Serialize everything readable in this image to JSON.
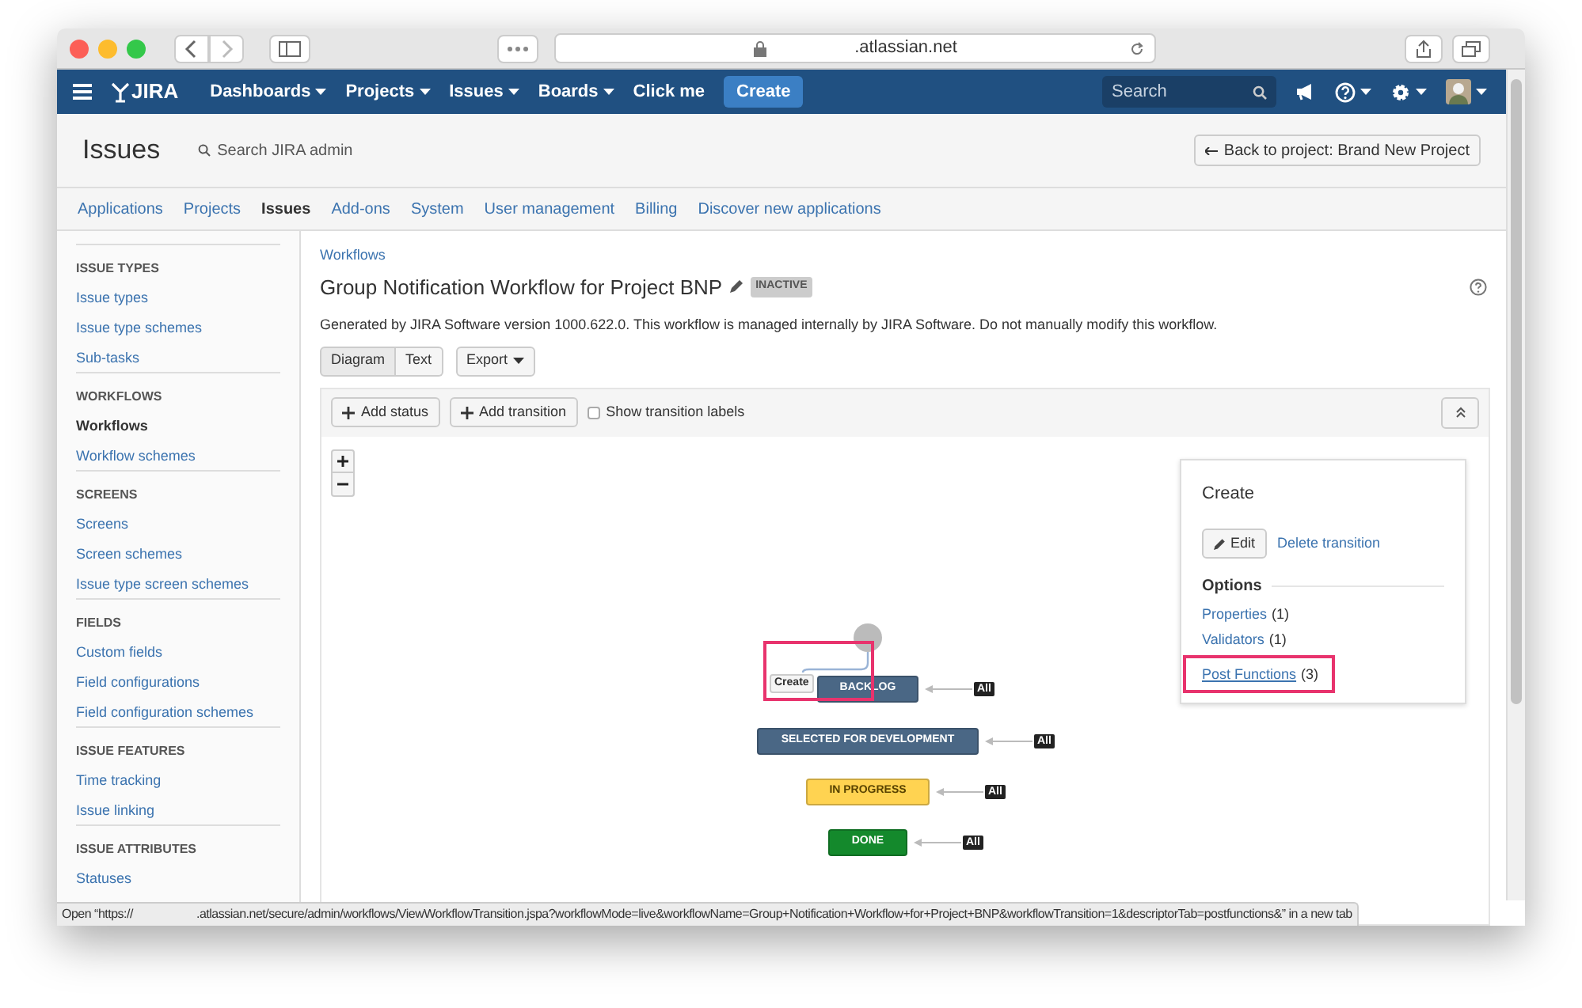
{
  "browser": {
    "address": ".atlassian.net"
  },
  "nav": {
    "logo": "JIRA",
    "items": [
      {
        "label": "Dashboards",
        "dropdown": true
      },
      {
        "label": "Projects",
        "dropdown": true
      },
      {
        "label": "Issues",
        "dropdown": true
      },
      {
        "label": "Boards",
        "dropdown": true
      },
      {
        "label": "Click me",
        "dropdown": false
      }
    ],
    "create": "Create",
    "search_placeholder": "Search"
  },
  "header": {
    "title": "Issues",
    "search": "Search JIRA admin",
    "back_button": "Back to project: Brand New Project"
  },
  "admin_tabs": [
    {
      "label": "Applications",
      "selected": false
    },
    {
      "label": "Projects",
      "selected": false
    },
    {
      "label": "Issues",
      "selected": true
    },
    {
      "label": "Add-ons",
      "selected": false
    },
    {
      "label": "System",
      "selected": false
    },
    {
      "label": "User management",
      "selected": false
    },
    {
      "label": "Billing",
      "selected": false
    },
    {
      "label": "Discover new applications",
      "selected": false
    }
  ],
  "sidebar": [
    {
      "heading": "ISSUE TYPES",
      "items": [
        {
          "label": "Issue types",
          "selected": false
        },
        {
          "label": "Issue type schemes",
          "selected": false
        },
        {
          "label": "Sub-tasks",
          "selected": false
        }
      ]
    },
    {
      "heading": "WORKFLOWS",
      "items": [
        {
          "label": "Workflows",
          "selected": true
        },
        {
          "label": "Workflow schemes",
          "selected": false
        }
      ]
    },
    {
      "heading": "SCREENS",
      "items": [
        {
          "label": "Screens",
          "selected": false
        },
        {
          "label": "Screen schemes",
          "selected": false
        },
        {
          "label": "Issue type screen schemes",
          "selected": false
        }
      ]
    },
    {
      "heading": "FIELDS",
      "items": [
        {
          "label": "Custom fields",
          "selected": false
        },
        {
          "label": "Field configurations",
          "selected": false
        },
        {
          "label": "Field configuration schemes",
          "selected": false
        }
      ]
    },
    {
      "heading": "ISSUE FEATURES",
      "items": [
        {
          "label": "Time tracking",
          "selected": false
        },
        {
          "label": "Issue linking",
          "selected": false
        }
      ]
    },
    {
      "heading": "ISSUE ATTRIBUTES",
      "items": [
        {
          "label": "Statuses",
          "selected": false
        }
      ]
    }
  ],
  "breadcrumb": "Workflows",
  "title": "Group Notification Workflow for Project BNP",
  "badge": "INACTIVE",
  "description": "Generated by JIRA Software version 1000.622.0. This workflow is managed internally by JIRA Software. Do not manually modify this workflow.",
  "view_toggle": [
    {
      "label": "Diagram",
      "selected": true
    },
    {
      "label": "Text",
      "selected": false
    }
  ],
  "export": "Export",
  "toolbar": {
    "add_status": "Add status",
    "add_transition": "Add transition",
    "show_labels": {
      "label": "Show transition labels",
      "checked": false
    }
  },
  "diagram": {
    "transition_label": "Create",
    "statuses": [
      {
        "label": "BACKLOG",
        "color": "#4a6785",
        "incoming": "All"
      },
      {
        "label": "SELECTED FOR DEVELOPMENT",
        "color": "#4a6785",
        "incoming": "All"
      },
      {
        "label": "IN PROGRESS",
        "color": "#ffd351",
        "incoming": "All"
      },
      {
        "label": "DONE",
        "color": "#14892c",
        "incoming": "All"
      }
    ]
  },
  "panel": {
    "title": "Create",
    "edit": "Edit",
    "delete": "Delete transition",
    "options_heading": "Options",
    "options": [
      {
        "label": "Properties",
        "count": "(1)",
        "highlighted": false
      },
      {
        "label": "Validators",
        "count": "(1)",
        "highlighted": false
      },
      {
        "label": "Post Functions",
        "count": "(3)",
        "highlighted": true
      }
    ]
  },
  "status_bar": {
    "prefix": "Open “https://",
    "url": ".atlassian.net/secure/admin/workflows/ViewWorkflowTransition.jspa?workflowMode=live&workflowName=Group+Notification+Workflow+for+Project+BNP&workflowTransition=1&descriptorTab=postfunctions&” in a new tab"
  }
}
